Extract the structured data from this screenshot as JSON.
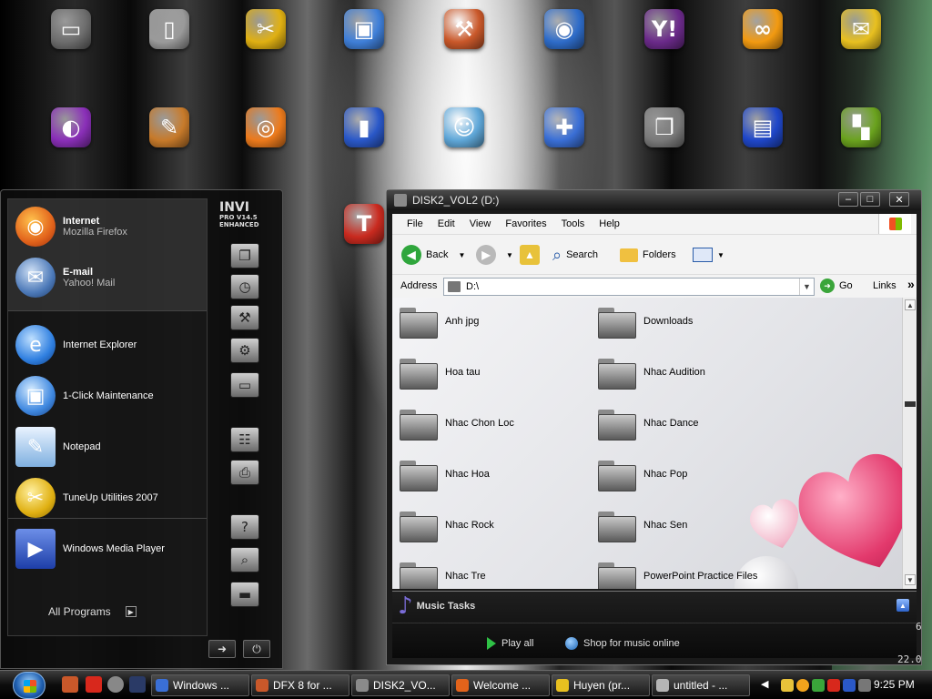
{
  "desktop": {
    "icons": [
      {
        "name": "computer",
        "glyph": "▭",
        "color": "#6d6d6d"
      },
      {
        "name": "recycle-bin",
        "glyph": "▯",
        "color": "#9a9a9a"
      },
      {
        "name": "tuneup-tools",
        "glyph": "✂",
        "color": "#e0b012"
      },
      {
        "name": "maintenance",
        "glyph": "▣",
        "color": "#3f7fd8"
      },
      {
        "name": "control-tools",
        "glyph": "⚒",
        "color": "#c9582a"
      },
      {
        "name": "firefox-browser",
        "glyph": "◉",
        "color": "#2e6cc9"
      },
      {
        "name": "yahoo-messenger",
        "glyph": "Y!",
        "color": "#6b2a8a"
      },
      {
        "name": "chat-app",
        "glyph": "∞",
        "color": "#f29a11"
      },
      {
        "name": "gift-mailbox",
        "glyph": "✉",
        "color": "#e8c020"
      },
      {
        "name": "media-app",
        "glyph": "◐",
        "color": "#8a2fb8"
      },
      {
        "name": "paint-palette",
        "glyph": "✎",
        "color": "#c77a2a"
      },
      {
        "name": "camera",
        "glyph": "◎",
        "color": "#ec7a1c"
      },
      {
        "name": "blue-folder",
        "glyph": "▮",
        "color": "#2a58c8"
      },
      {
        "name": "avatar-app",
        "glyph": "☺",
        "color": "#5fa7d8"
      },
      {
        "name": "network-app",
        "glyph": "✚",
        "color": "#3a6fd6"
      },
      {
        "name": "documents",
        "glyph": "❐",
        "color": "#7a7a7a"
      },
      {
        "name": "floppy-save",
        "glyph": "▤",
        "color": "#1f47c9"
      },
      {
        "name": "cleaner-app",
        "glyph": "▚",
        "color": "#6aa21e"
      }
    ],
    "extra_icon": {
      "name": "book-app",
      "glyph": "T",
      "color": "#c92a1f"
    }
  },
  "start_menu": {
    "pinned": [
      {
        "title": "Internet",
        "subtitle": "Mozilla Firefox",
        "icon": "firefox-icon",
        "color": "#e2631b"
      },
      {
        "title": "E-mail",
        "subtitle": "Yahoo! Mail",
        "icon": "mail-icon",
        "color": "#4c79b8"
      }
    ],
    "recent": [
      {
        "label": "Internet Explorer",
        "icon": "internet-explorer-icon",
        "color": "#2f7fe0"
      },
      {
        "label": "1-Click Maintenance",
        "icon": "maintenance-icon",
        "color": "#3f88e0"
      },
      {
        "label": "Notepad",
        "icon": "notepad-icon",
        "color": "#7fb0e0"
      },
      {
        "label": "TuneUp Utilities 2007",
        "icon": "tuneup-icon",
        "color": "#e0b012"
      },
      {
        "label": "Windows Media Player",
        "icon": "media-player-icon",
        "color": "#2a58c8"
      }
    ],
    "all_programs": "All Programs",
    "brand_text": "PRO V14.5 ENHANCED"
  },
  "explorer": {
    "title": "DISK2_VOL2 (D:)",
    "menu": [
      "File",
      "Edit",
      "View",
      "Favorites",
      "Tools",
      "Help"
    ],
    "toolbar": {
      "back": "Back",
      "search": "Search",
      "folders": "Folders"
    },
    "address_label": "Address",
    "address_value": "D:\\",
    "go": "Go",
    "links": "Links",
    "links_chevron": "»",
    "folders": [
      "Anh jpg",
      "Downloads",
      "Hoa tau",
      "Nhac Audition",
      "Nhac Chon Loc",
      "Nhac Dance",
      "Nhac Hoa",
      "Nhac Pop",
      "Nhac Rock",
      "Nhac Sen",
      "Nhac Tre",
      "PowerPoint Practice Files"
    ],
    "task_panel": {
      "title": "Music Tasks",
      "play_all": "Play all",
      "shop": "Shop for music online"
    },
    "side_digits": [
      "6",
      "22.0"
    ]
  },
  "taskbar": {
    "buttons": [
      {
        "label": "Windows ...",
        "color": "#3a6fd6"
      },
      {
        "label": "DFX 8 for ...",
        "color": "#c9582a"
      },
      {
        "label": "DISK2_VO...",
        "color": "#8a8a8a"
      },
      {
        "label": "Welcome ...",
        "color": "#e2631b"
      },
      {
        "label": "Huyen (pr...",
        "color": "#e8c020"
      },
      {
        "label": "untitled - ...",
        "color": "#b5b5b5"
      }
    ],
    "clock": "9:25 PM"
  }
}
